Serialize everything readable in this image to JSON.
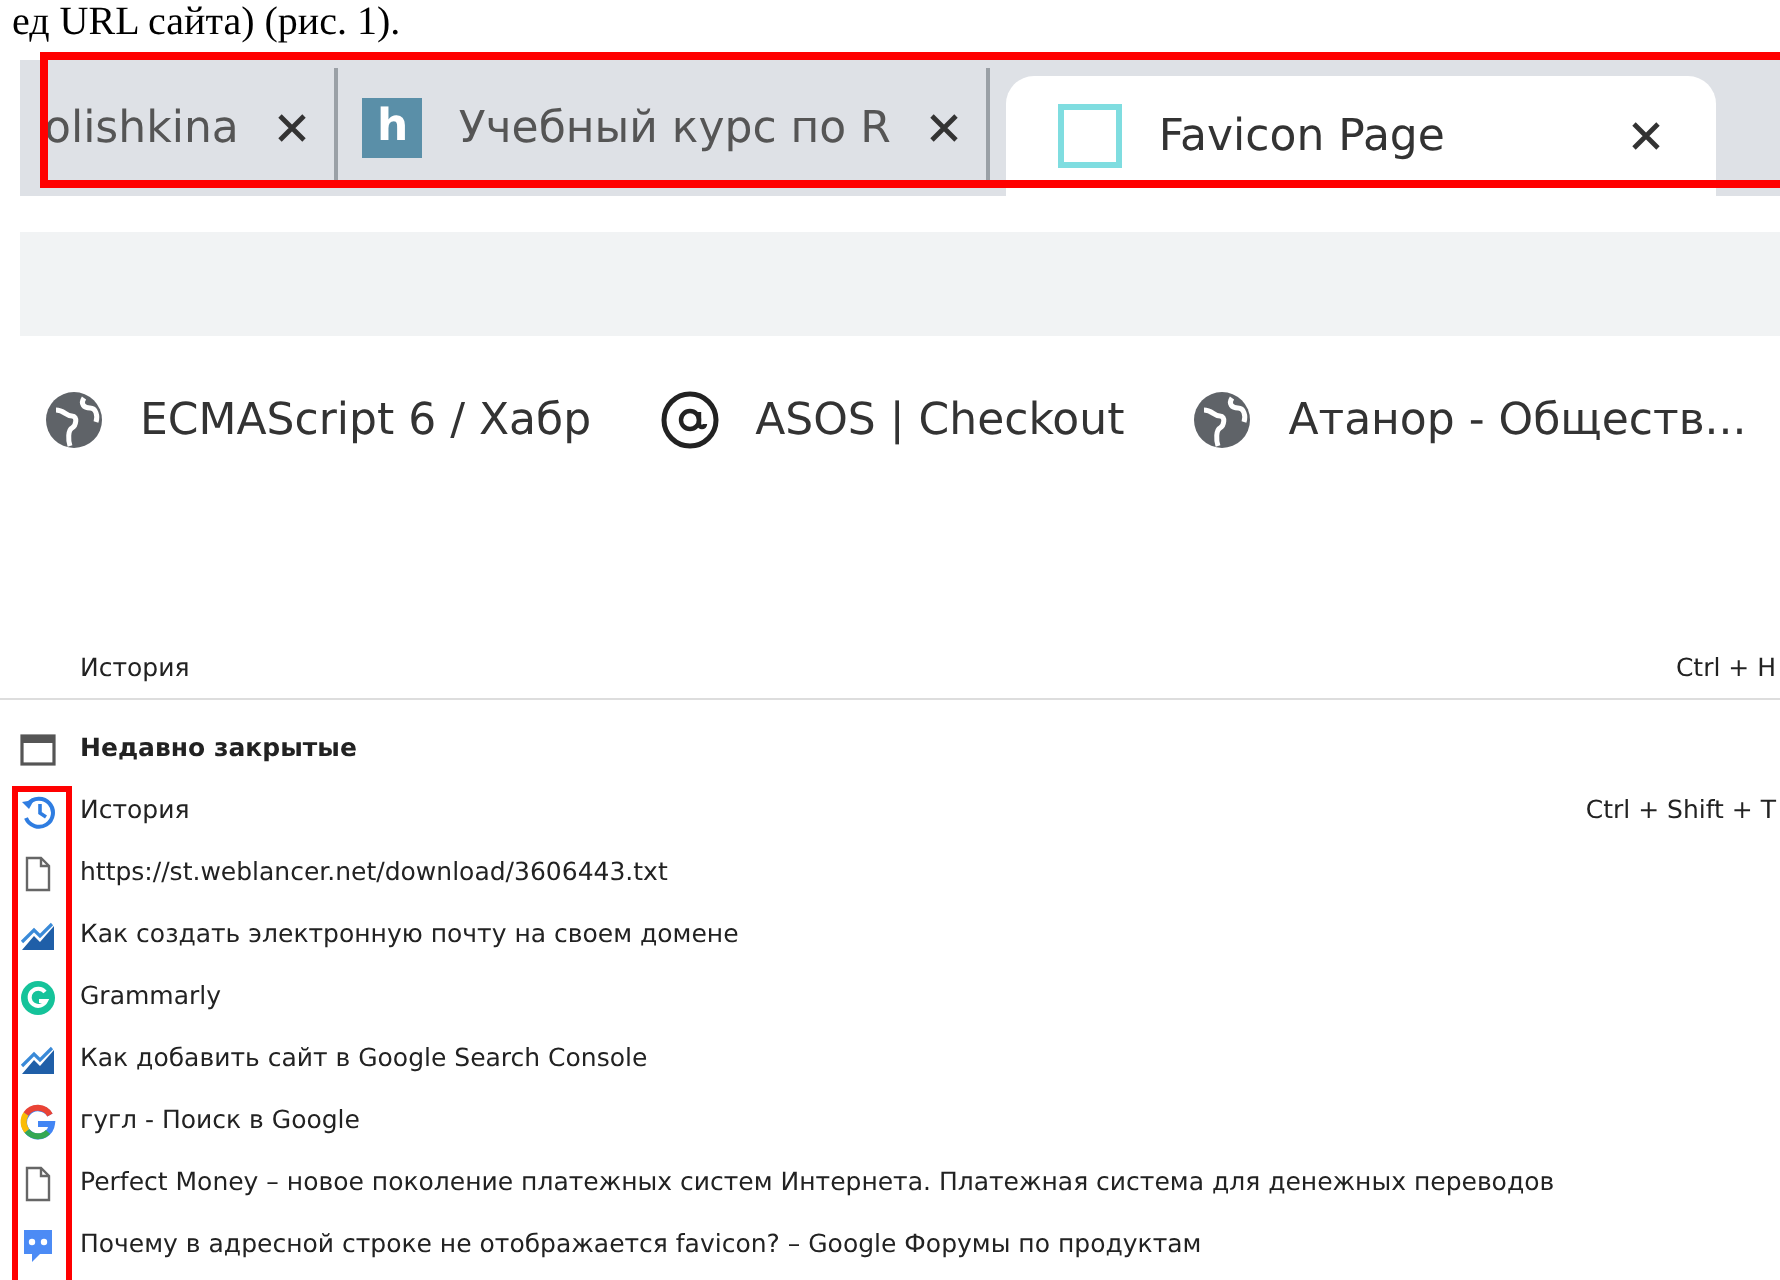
{
  "caption": "ед URL сайта) (рис. 1).",
  "tabs": [
    {
      "title": "olishkina",
      "kind": "none",
      "selected": false
    },
    {
      "title": "Учебный курс по R",
      "kind": "letter",
      "icon_text": "h",
      "selected": false
    },
    {
      "title": "Favicon Page",
      "kind": "blank",
      "selected": true
    }
  ],
  "bookmarks": [
    {
      "title": "ECMAScript 6 / Хабр",
      "kind": "globe"
    },
    {
      "title": "ASOS | Checkout",
      "kind": "at"
    },
    {
      "title": "Атанор - Обществ...",
      "kind": "globe"
    }
  ],
  "menu": {
    "title": "История",
    "shortcut": "Ctrl + H",
    "items": [
      {
        "label": "Недавно закрытые",
        "kind": "window",
        "bold": true
      },
      {
        "label": "История",
        "kind": "history",
        "shortcut": "Ctrl + Shift + T",
        "bold": false
      },
      {
        "label": "https://st.weblancer.net/download/3606443.txt",
        "kind": "file",
        "bold": false
      },
      {
        "label": "Как создать электронную почту на своем домене",
        "kind": "chart",
        "bold": false
      },
      {
        "label": "Grammarly",
        "kind": "grammarly",
        "bold": false
      },
      {
        "label": "Как добавить сайт в Google Search Console",
        "kind": "chart",
        "bold": false
      },
      {
        "label": "гугл - Поиск в Google",
        "kind": "google",
        "bold": false
      },
      {
        "label": "Perfect Money – новое поколение платежных систем Интернета. Платежная система для денежных переводов",
        "kind": "file",
        "bold": false
      },
      {
        "label": "Почему в адресной строке не отображается favicon? – Google Форумы по продуктам",
        "kind": "forum",
        "bold": false
      }
    ]
  }
}
